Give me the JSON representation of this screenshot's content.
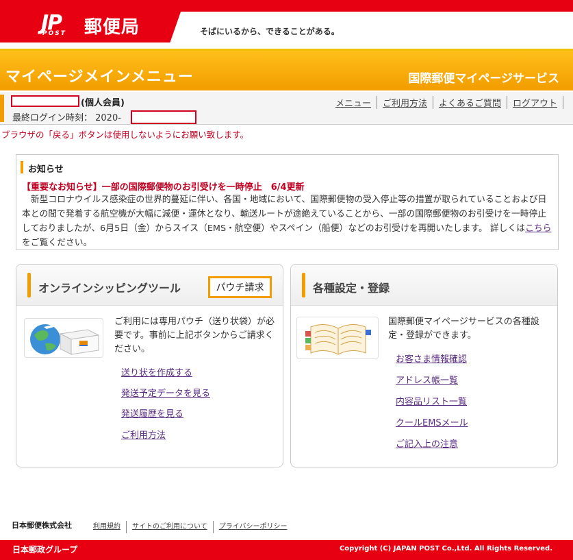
{
  "header": {
    "logo_mark": "JP",
    "logo_post": "POST",
    "logo_text": "郵便局",
    "tagline": "そばにいるから、できることがある。"
  },
  "title_bar": {
    "title": "マイページメインメニュー",
    "service": "国際郵便マイページサービス"
  },
  "user": {
    "member_type": "(個人会員)",
    "last_login_label": "最終ログイン時刻： 2020-"
  },
  "nav": [
    "メニュー",
    "ご利用方法",
    "よくあるご質問",
    "ログアウト"
  ],
  "warning": "ブラウザの「戻る」ボタンは使用しないようにお願い致します。",
  "notice": {
    "title": "お知らせ",
    "headline": "【重要なお知らせ】一部の国際郵便物のお引受けを一時停止　6/4更新",
    "body_before": "　新型コロナウイルス感染症の世界的蔓延に伴い、各国・地域において、国際郵便物の受入停止等の措置が取られていることおよび日本との間で発着する航空機が大幅に減便・運休となり、輸送ルートが途絶えていることから、一部の国際郵便物のお引受けを一時停止しておりましたが、6月5日（金）からスイス（EMS・航空便）やスペイン（船便）などのお引受けを再開いたします。 詳しくは",
    "link": "こちら",
    "body_after": "をご覧ください。"
  },
  "panel_left": {
    "title": "オンラインシッピングツール",
    "button": "パウチ請求",
    "description": "ご利用には専用パウチ（送り状袋）が必要です。事前に上記ボタンからご請求ください。",
    "links": [
      "送り状を作成する",
      "発送予定データを見る",
      "発送履歴を見る",
      "ご利用方法"
    ]
  },
  "panel_right": {
    "title": "各種設定・登録",
    "description": "国際郵便マイページサービスの各種設定・登録ができます。",
    "links": [
      "お客さま情報確認",
      "アドレス帳一覧",
      "内容品リスト一覧",
      "クールEMSメール",
      "ご記入上の注意"
    ]
  },
  "footer": {
    "company": "日本郵便株式会社",
    "links": [
      "利用規約",
      "サイトのご利用について",
      "プライバシーポリシー"
    ],
    "group_logo": "日本郵政グループ",
    "copyright": "Copyright (C) JAPAN POST Co.,Ltd.  All Rights Reserved."
  },
  "colors": {
    "brand_red": "#e60012",
    "accent_orange": "#f29c00",
    "link_purple": "#5a2d82"
  }
}
